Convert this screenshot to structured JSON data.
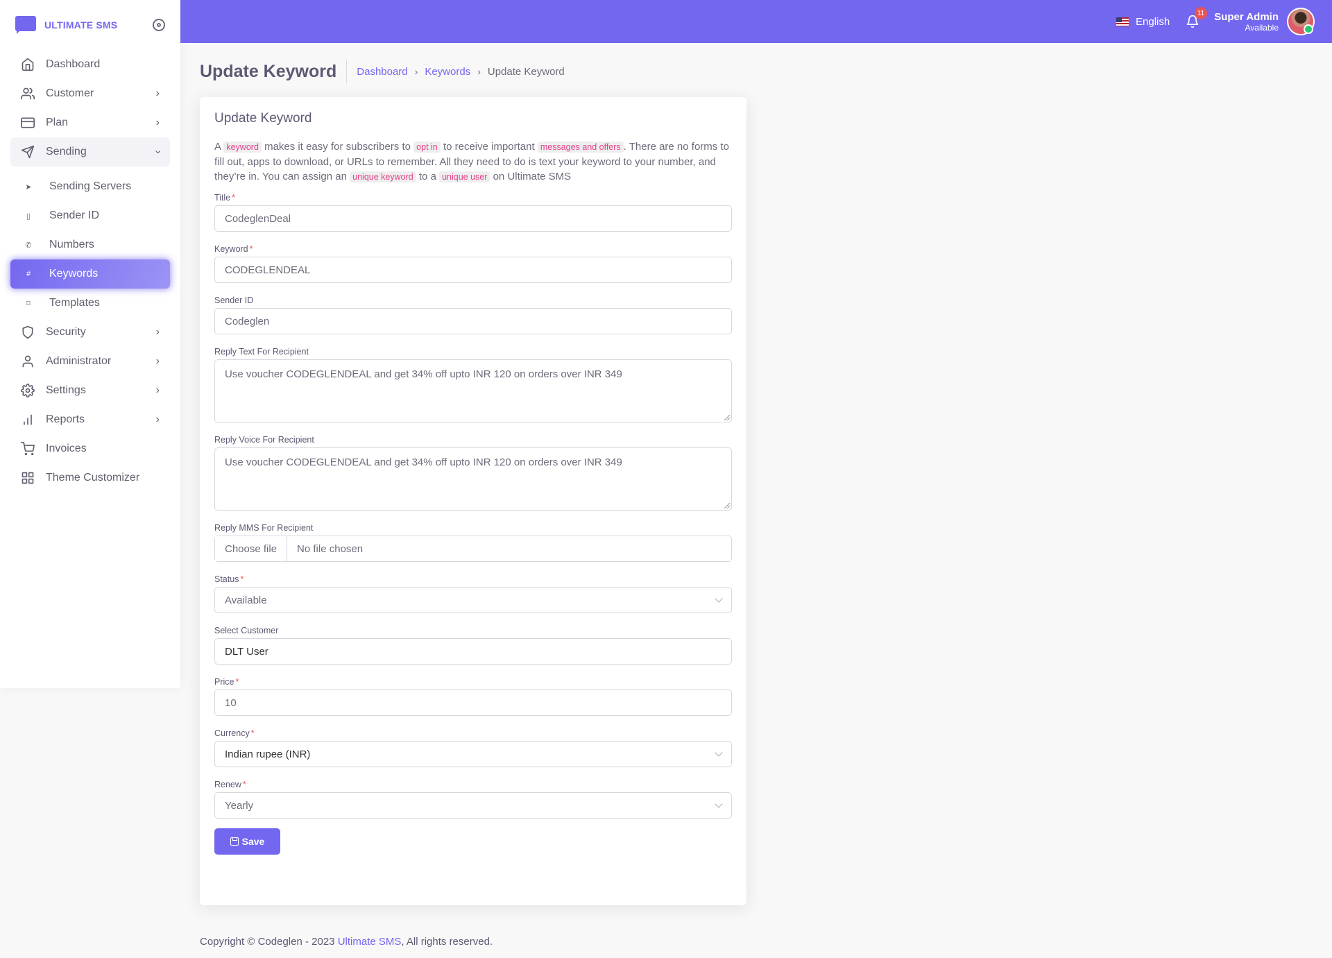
{
  "brand": {
    "name": "ULTIMATE SMS"
  },
  "topbar": {
    "language": "English",
    "notifications_count": "11",
    "user_name": "Super Admin",
    "user_status": "Available"
  },
  "sidebar": {
    "items": [
      {
        "label": "Dashboard",
        "icon": "home-icon"
      },
      {
        "label": "Customer",
        "icon": "users-icon"
      },
      {
        "label": "Plan",
        "icon": "credit-card-icon"
      },
      {
        "label": "Sending",
        "icon": "send-icon"
      },
      {
        "label": "Security",
        "icon": "shield-icon"
      },
      {
        "label": "Administrator",
        "icon": "user-icon"
      },
      {
        "label": "Settings",
        "icon": "gear-icon"
      },
      {
        "label": "Reports",
        "icon": "bar-chart-icon"
      },
      {
        "label": "Invoices",
        "icon": "cart-icon"
      },
      {
        "label": "Theme Customizer",
        "icon": "grid-icon"
      }
    ],
    "sending_sub": [
      {
        "label": "Sending Servers"
      },
      {
        "label": "Sender ID"
      },
      {
        "label": "Numbers"
      },
      {
        "label": "Keywords"
      },
      {
        "label": "Templates"
      }
    ]
  },
  "page": {
    "title": "Update Keyword",
    "breadcrumb": [
      "Dashboard",
      "Keywords",
      "Update Keyword"
    ]
  },
  "card": {
    "title": "Update Keyword",
    "intro": {
      "t1": "A",
      "c1": "keyword",
      "t2": "makes it easy for subscribers to",
      "c2": "opt in",
      "t3": "to receive important",
      "c3": "messages and offers",
      "t4": ". There are no forms to fill out, apps to download, or URLs to remember. All they need to do is text your keyword to your number, and they’re in. You can assign an",
      "c4": "unique keyword",
      "t5": "to a",
      "c5": "unique user",
      "t6": "on Ultimate SMS"
    },
    "fields": {
      "title": {
        "label": "Title",
        "value": "CodeglenDeal"
      },
      "keyword": {
        "label": "Keyword",
        "value": "CODEGLENDEAL"
      },
      "sender_id": {
        "label": "Sender ID",
        "value": "Codeglen"
      },
      "reply_text": {
        "label": "Reply Text For Recipient",
        "value": "Use voucher CODEGLENDEAL and get 34% off upto INR 120 on orders over INR 349"
      },
      "reply_voice": {
        "label": "Reply Voice For Recipient",
        "value": "Use voucher CODEGLENDEAL and get 34% off upto INR 120 on orders over INR 349"
      },
      "reply_mms": {
        "label": "Reply MMS For Recipient",
        "button": "Choose file",
        "file": "No file chosen"
      },
      "status": {
        "label": "Status",
        "value": "Available"
      },
      "customer": {
        "label": "Select Customer",
        "value": "DLT User"
      },
      "price": {
        "label": "Price",
        "value": "10"
      },
      "currency": {
        "label": "Currency",
        "value": "Indian rupee (INR)"
      },
      "renew": {
        "label": "Renew",
        "value": "Yearly"
      }
    },
    "save_label": "Save"
  },
  "footer": {
    "prefix": "Copyright © Codeglen - 2023",
    "link": "Ultimate SMS",
    "suffix": ", All rights reserved."
  },
  "colors": {
    "primary": "#7367f0",
    "danger": "#ea5455"
  }
}
